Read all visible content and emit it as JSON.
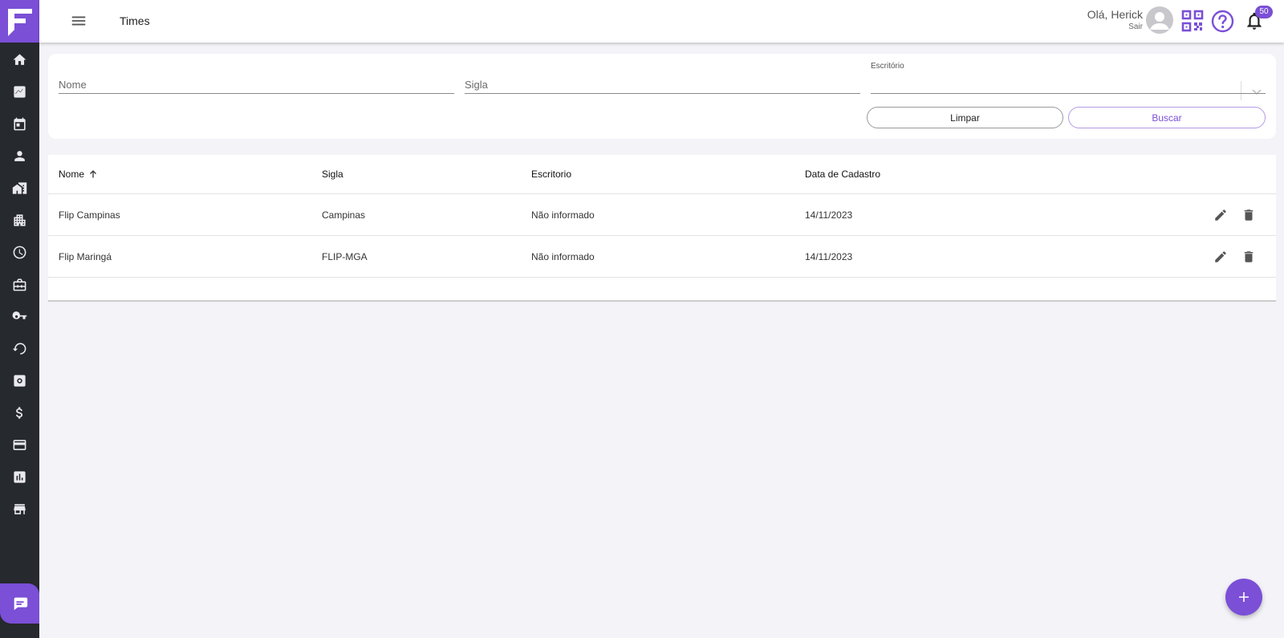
{
  "header": {
    "title": "Times",
    "greeting": "Olá, Herick",
    "logout": "Sair",
    "notifications_count": "50"
  },
  "filters": {
    "nome_placeholder": "Nome",
    "sigla_placeholder": "Sigla",
    "escritorio_label": "Escritório",
    "escritorio_value": "",
    "clear_label": "Limpar",
    "search_label": "Buscar"
  },
  "table": {
    "columns": [
      "Nome",
      "Sigla",
      "Escritorio",
      "Data de Cadastro"
    ],
    "sort": "Nome ascending",
    "rows": [
      {
        "nome": "Flip Campinas",
        "sigla": "Campinas",
        "escritorio": "Não informado",
        "data": "14/11/2023"
      },
      {
        "nome": "Flip Maringá",
        "sigla": "FLIP-MGA",
        "escritorio": "Não informado",
        "data": "14/11/2023"
      }
    ]
  },
  "sidebar": {
    "items": [
      "home-icon",
      "chart-line-icon",
      "calendar-icon",
      "person-icon",
      "buildings-icon",
      "apartment-icon",
      "clock-icon",
      "briefcase-icon",
      "key-icon",
      "restore-icon",
      "settings-box-icon",
      "dollar-icon",
      "credit-card-icon",
      "bar-report-icon",
      "store-icon"
    ]
  },
  "colors": {
    "accent": "#7b4fd6",
    "sidebar_bg": "#26292e",
    "page_bg": "#f3f3f8"
  }
}
